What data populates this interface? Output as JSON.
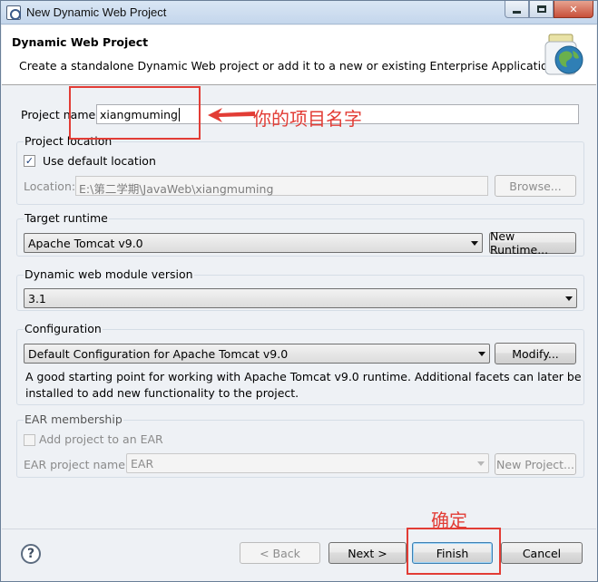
{
  "window": {
    "title": "New Dynamic Web Project"
  },
  "header": {
    "title": "Dynamic Web Project",
    "description": "Create a standalone Dynamic Web project or add it to a new or existing Enterprise Application."
  },
  "project_name": {
    "label": "Project name:",
    "value": "xiangmuming"
  },
  "project_location": {
    "title": "Project location",
    "use_default_label": "Use default location",
    "use_default_checked": true,
    "location_label": "Location:",
    "location_value": "E:\\第二学期\\JavaWeb\\xiangmuming",
    "browse_label": "Browse..."
  },
  "target_runtime": {
    "title": "Target runtime",
    "selected": "Apache Tomcat v9.0",
    "new_runtime_label": "New Runtime..."
  },
  "module_version": {
    "title": "Dynamic web module version",
    "selected": "3.1"
  },
  "configuration": {
    "title": "Configuration",
    "selected": "Default Configuration for Apache Tomcat v9.0",
    "modify_label": "Modify...",
    "description_line1": "A good starting point for working with Apache Tomcat v9.0 runtime. Additional facets can later be",
    "description_line2": "installed to add new functionality to the project."
  },
  "ear": {
    "title": "EAR membership",
    "add_label": "Add project to an EAR",
    "ear_name_label": "EAR project name:",
    "ear_name_value": "EAR",
    "new_project_label": "New Project..."
  },
  "footer": {
    "help_glyph": "?",
    "back_label": "< Back",
    "next_label": "Next >",
    "finish_label": "Finish",
    "cancel_label": "Cancel"
  },
  "annotations": {
    "project_name_note": "你的项目名字",
    "finish_note": "确定",
    "color": "#e23c35"
  },
  "icons": {
    "window": "eclipse-window-icon",
    "header": "web-project-wizard-icon",
    "help": "help-icon"
  }
}
